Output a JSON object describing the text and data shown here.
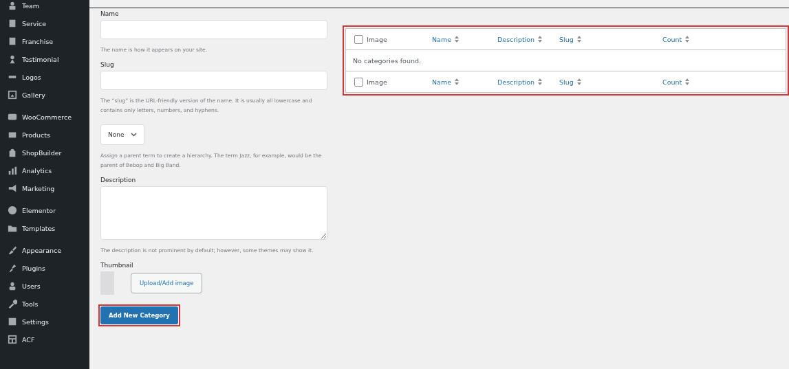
{
  "sidebar": {
    "groups": [
      {
        "items": [
          "Team",
          "Service",
          "Franchise",
          "Testimonial",
          "Logos",
          "Gallery"
        ]
      },
      {
        "items": [
          "WooCommerce",
          "Products",
          "ShopBuilder",
          "Analytics",
          "Marketing"
        ]
      },
      {
        "items": [
          "Elementor",
          "Templates"
        ]
      },
      {
        "items": [
          "Appearance",
          "Plugins",
          "Users",
          "Tools",
          "Settings",
          "ACF"
        ]
      }
    ]
  },
  "form": {
    "fields": [
      {
        "kind": "input",
        "label": "Name",
        "help": "The name is how it appears on your site."
      },
      {
        "kind": "input",
        "label": "Slug",
        "help": "The “slug” is the URL-friendly version of the name. It is usually all lowercase and contains only letters, numbers, and hyphens."
      },
      {
        "kind": "select",
        "value": "None",
        "help": "Assign a parent term to create a hierarchy. The term Jazz, for example, would be the parent of Bebop and Big Band."
      },
      {
        "kind": "textarea",
        "label": "Description",
        "help": "The description is not prominent by default; however, some themes may show it."
      },
      {
        "kind": "thumbnail",
        "label": "Thumbnail",
        "button": "Upload/Add image"
      }
    ],
    "submit": {
      "label": "Add New Category",
      "highlighted": true
    }
  },
  "table": {
    "highlighted": true,
    "header_columns": [
      {
        "label": "Image",
        "sortable": false
      },
      {
        "label": "Name",
        "sortable": true
      },
      {
        "label": "Description",
        "sortable": true
      },
      {
        "label": "Slug",
        "sortable": true
      },
      {
        "label": "Count",
        "sortable": true
      }
    ],
    "footer_columns": [
      {
        "label": "Image",
        "sortable": false
      },
      {
        "label": "Name",
        "sortable": true
      },
      {
        "label": "Description",
        "sortable": true
      },
      {
        "label": "Slug",
        "sortable": true
      },
      {
        "label": "Count",
        "sortable": true
      }
    ],
    "header_checked": false,
    "empty_message": "No categories found.",
    "footer_checked": false
  }
}
